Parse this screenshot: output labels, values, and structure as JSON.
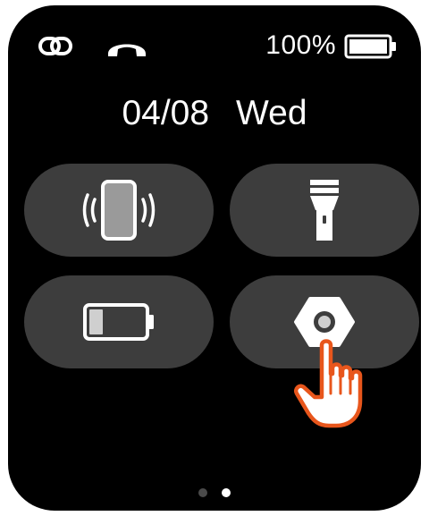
{
  "status_bar": {
    "link_icon": "link-icon",
    "call_icon": "phone-hangup-icon",
    "battery_percent": "100%",
    "battery_icon": "battery-full-icon"
  },
  "date": {
    "day_month": "04/08",
    "weekday": "Wed"
  },
  "tiles": [
    {
      "name": "vibrate-mode",
      "icon": "phone-vibrate-icon"
    },
    {
      "name": "flashlight",
      "icon": "flashlight-icon"
    },
    {
      "name": "power-saving",
      "icon": "battery-low-icon"
    },
    {
      "name": "settings",
      "icon": "hex-nut-settings-icon"
    }
  ],
  "pager": {
    "page_count": 2,
    "current_page": 2
  },
  "overlay": {
    "pointer_icon": "tap-hand-icon"
  },
  "colors": {
    "screen_background": "#000000",
    "tile_background": "#3d3d3d",
    "foreground": "#ffffff",
    "icon_light_gray": "#cfcfcf",
    "phone_body_gray": "#9a9a9a",
    "hand_accent": "#e8561c"
  }
}
